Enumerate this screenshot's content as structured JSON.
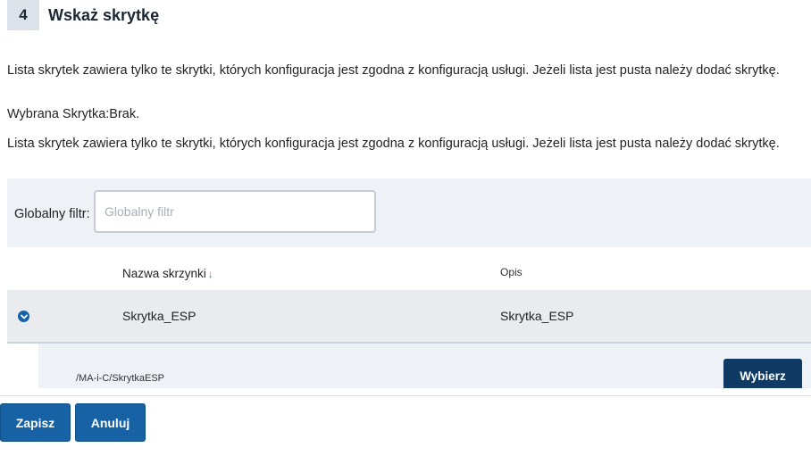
{
  "step": {
    "number": "4",
    "title": "Wskaż skrytkę"
  },
  "info_text_1": "Lista skrytek zawiera tylko te skrytki, których konfiguracja jest zgodna z konfiguracją usługi. Jeżeli lista jest pusta należy dodać skrytkę.",
  "selected_text": "Wybrana Skrytka:Brak.",
  "info_text_2": "Lista skrytek zawiera tylko te skrytki, których konfiguracja jest zgodna z konfiguracją usługi. Jeżeli lista jest pusta należy dodać skrytkę.",
  "filter": {
    "label": "Globalny filtr:",
    "placeholder": "Globalny filtr",
    "value": ""
  },
  "table": {
    "columns": {
      "name": "Nazwa skrzynki",
      "sort_arrow": "↓",
      "description": "Opis"
    },
    "rows": [
      {
        "name": "Skrytka_ESP",
        "description": "Skrytka_ESP",
        "path": "/MA-i-C/SkrytkaESP",
        "select_label": "Wybierz"
      }
    ]
  },
  "actions": {
    "save_label": "Zapisz",
    "cancel_label": "Anuluj"
  },
  "colors": {
    "primary": "#1762a4",
    "dark_primary": "#0e3a63",
    "panel_bg": "#eef2f7"
  }
}
